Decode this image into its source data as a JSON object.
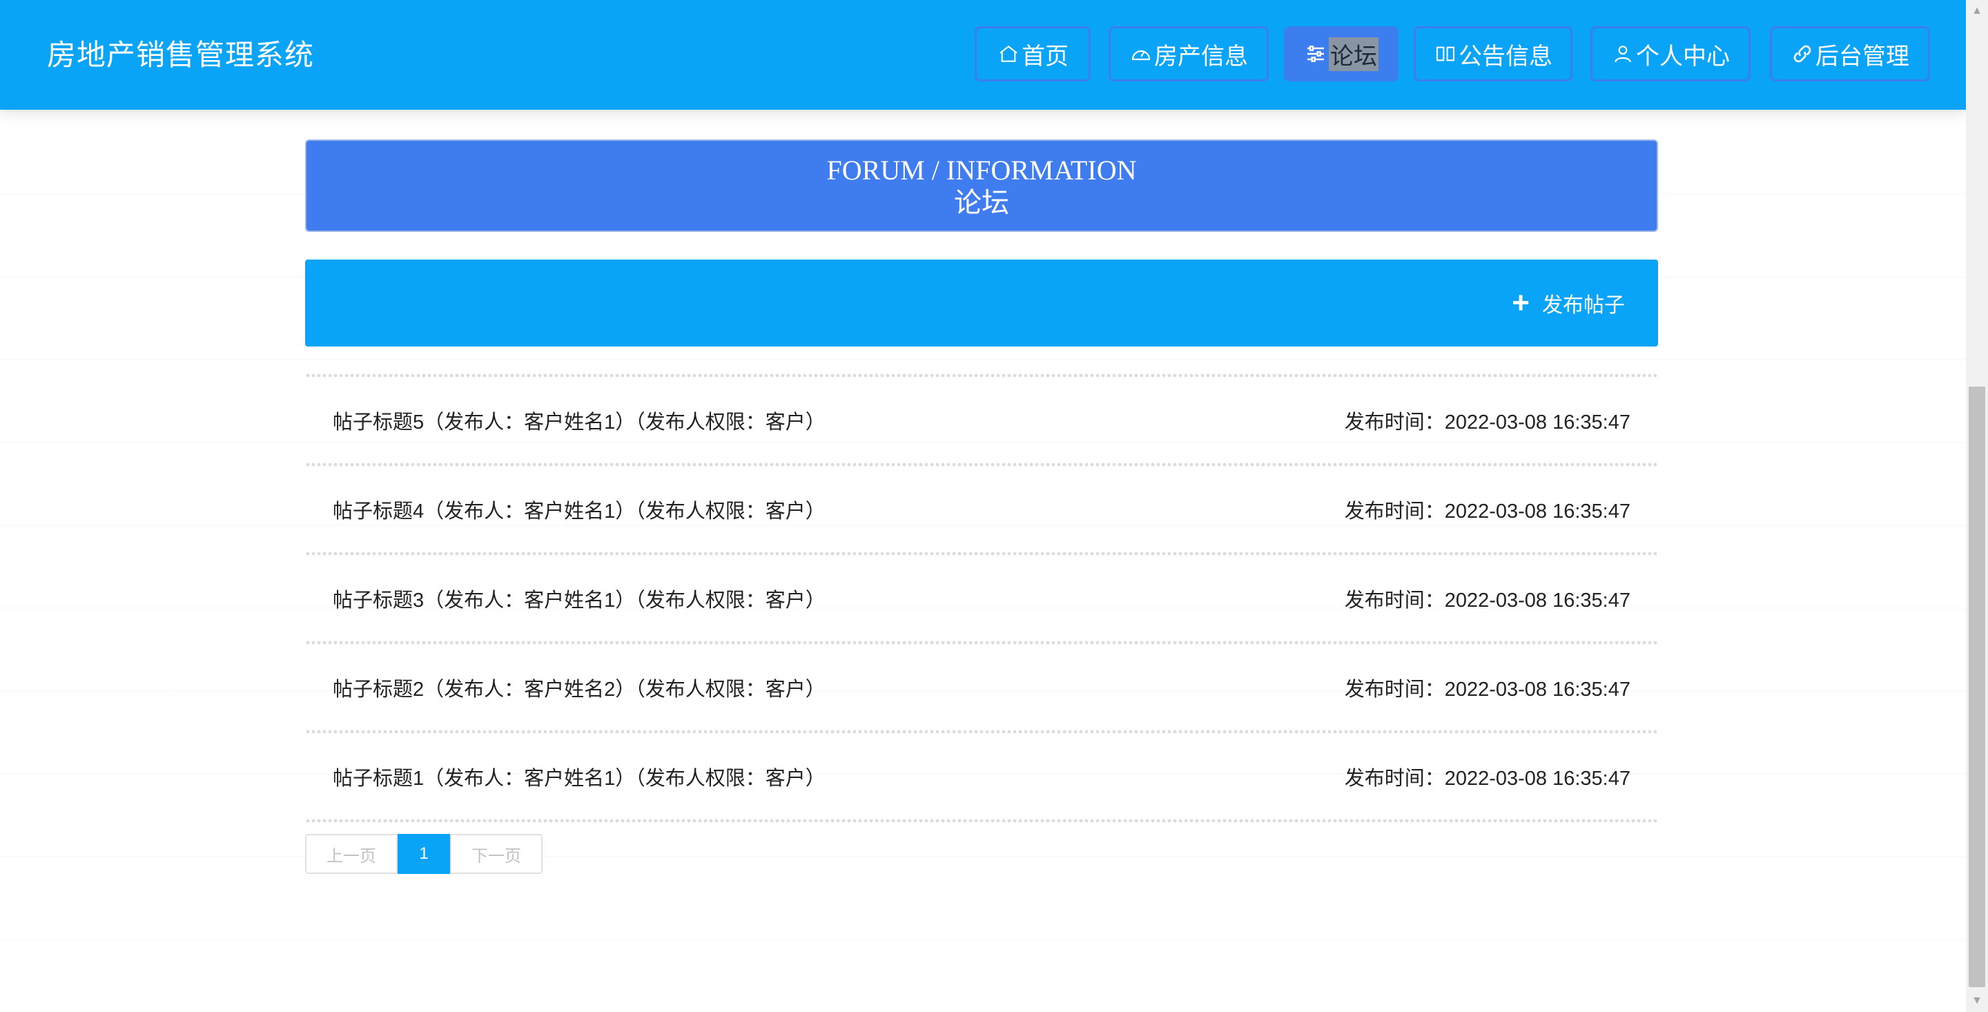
{
  "header": {
    "title": "房地产销售管理系统",
    "nav": [
      {
        "label": "首页",
        "icon": "home-icon"
      },
      {
        "label": "房产信息",
        "icon": "dashboard-icon"
      },
      {
        "label": "论坛",
        "icon": "sliders-icon",
        "active": true
      },
      {
        "label": "公告信息",
        "icon": "reader-icon"
      },
      {
        "label": "个人中心",
        "icon": "user-icon"
      },
      {
        "label": "后台管理",
        "icon": "link-icon"
      }
    ]
  },
  "banner": {
    "en": "FORUM / INFORMATION",
    "cn": "论坛"
  },
  "actions": {
    "publish_label": "发布帖子",
    "publish_icon": "plus-icon"
  },
  "posts": [
    {
      "title": "帖子标题5（发布人：客户姓名1）（发布人权限：客户）",
      "time": "发布时间：2022-03-08 16:35:47"
    },
    {
      "title": "帖子标题4（发布人：客户姓名1）（发布人权限：客户）",
      "time": "发布时间：2022-03-08 16:35:47"
    },
    {
      "title": "帖子标题3（发布人：客户姓名1）（发布人权限：客户）",
      "time": "发布时间：2022-03-08 16:35:47"
    },
    {
      "title": "帖子标题2（发布人：客户姓名2）（发布人权限：客户）",
      "time": "发布时间：2022-03-08 16:35:47"
    },
    {
      "title": "帖子标题1（发布人：客户姓名1）（发布人权限：客户）",
      "time": "发布时间：2022-03-08 16:35:47"
    }
  ],
  "pagination": {
    "prev": "上一页",
    "current": "1",
    "next": "下一页"
  },
  "colors": {
    "primary": "#09a4f7",
    "accent": "#3c7df0"
  }
}
